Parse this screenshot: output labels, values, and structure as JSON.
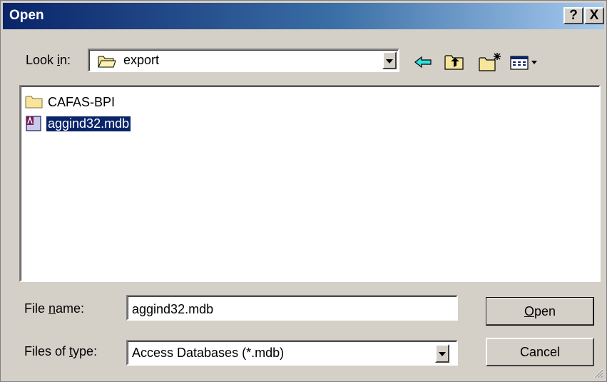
{
  "window": {
    "title": "Open",
    "help_label": "?",
    "close_label": "X"
  },
  "lookin": {
    "label_pre": "Look ",
    "label_accel": "i",
    "label_post": "n:",
    "value": "export"
  },
  "toolbar": {
    "back_icon": "back-arrow-icon",
    "up_icon": "up-one-level-icon",
    "new_folder_icon": "new-folder-icon",
    "view_icon": "view-menu-icon"
  },
  "files": [
    {
      "name": "CAFAS-BPI",
      "type": "folder",
      "selected": false
    },
    {
      "name": "aggind32.mdb",
      "type": "access-database",
      "selected": true
    }
  ],
  "filename": {
    "label_pre": "File ",
    "label_accel": "n",
    "label_post": "ame:",
    "value": "aggind32.mdb"
  },
  "filetype": {
    "label_pre": "Files of ",
    "label_accel": "t",
    "label_post": "ype:",
    "value": "Access Databases (*.mdb)"
  },
  "buttons": {
    "open_accel": "O",
    "open_rest": "pen",
    "cancel": "Cancel"
  },
  "colors": {
    "titlebar_start": "#0a246a",
    "titlebar_end": "#a6caf0",
    "face": "#d4d0c8",
    "selection": "#0a246a"
  }
}
